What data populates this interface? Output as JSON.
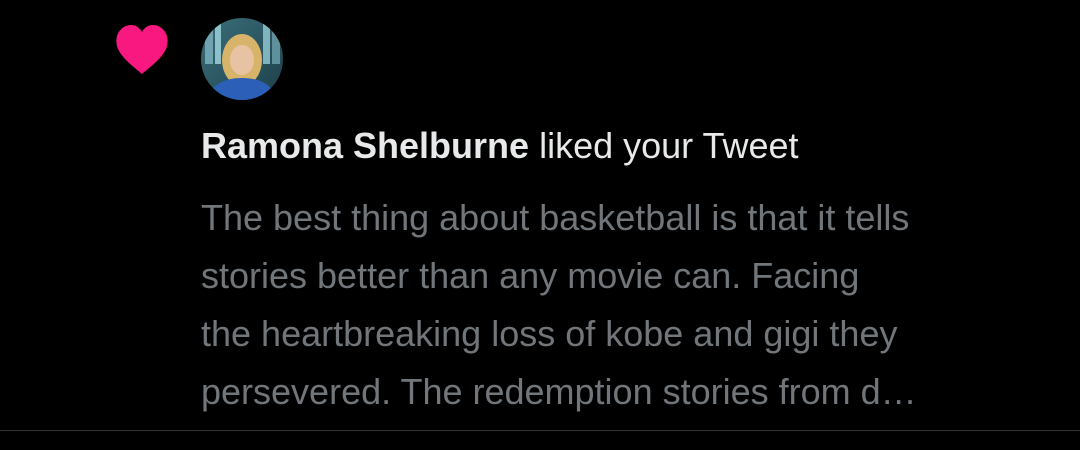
{
  "notification": {
    "icon": "heart-icon",
    "accent_color": "#f91880",
    "avatar_icon": "avatar-photo",
    "user_name": "Ramona Shelburne",
    "action_text": "liked your Tweet",
    "tweet_lines": [
      "The best thing about basketball is that it tells",
      "stories better than any movie can. Facing",
      "the heartbreaking loss of kobe and gigi they",
      "persevered. The redemption stories from d…"
    ]
  }
}
